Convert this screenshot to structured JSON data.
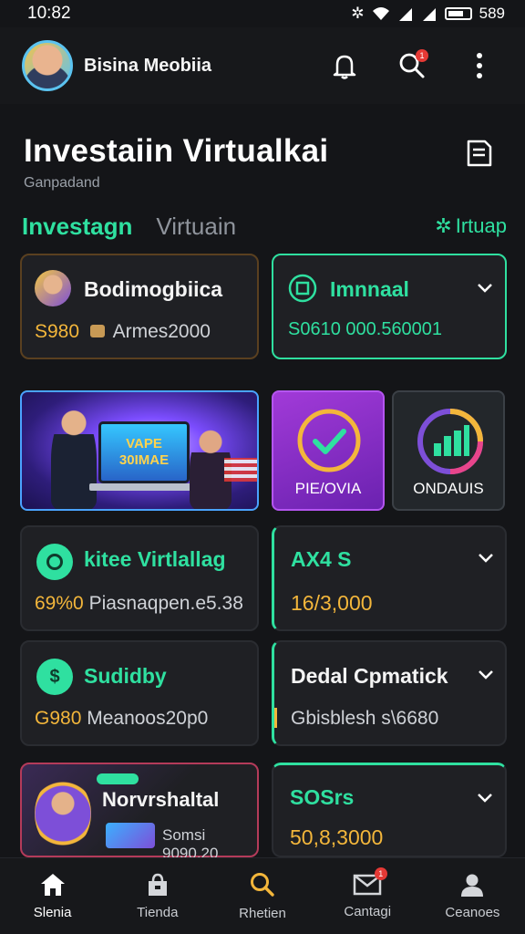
{
  "status_bar": {
    "time": "10:82",
    "battery": "589"
  },
  "header": {
    "user_name": "Bisina Meobiia",
    "notification_badge": "1"
  },
  "page": {
    "title": "Investaiin Virtualkai",
    "subtitle": "Ganpadand"
  },
  "tabs": [
    {
      "label": "Investagn",
      "active": true
    },
    {
      "label": "Virtuain",
      "active": false
    }
  ],
  "tab_right": "Irtuap",
  "cards": [
    {
      "title": "Bodimogbiica",
      "value_prefix": "S980",
      "value_rest": "Armes2000"
    },
    {
      "title": "Imnnaal",
      "value": "S0610 000.560001"
    },
    {
      "title": "kitee Virtlallag",
      "value_prefix": "69%0",
      "value_rest": "Piasnaqpen.e5.38"
    },
    {
      "title": "AX4 S",
      "value": "16/3,000"
    },
    {
      "title": "Sudidby",
      "value_prefix": "G980",
      "value_rest": "Meanoos20p0"
    },
    {
      "title": "Dedal Cpmatick",
      "value": "Gbisblesh s\\6680"
    },
    {
      "title": "Norvrshaltal",
      "value": "Somsi 9090.20"
    },
    {
      "title": "SOSrs",
      "value": "50,8,3000"
    }
  ],
  "promo": {
    "screen_line1": "VAPE",
    "screen_line2": "30IMAE"
  },
  "promo_mini": [
    {
      "label": "PIE/OVIA",
      "color": "#8f2fd0"
    },
    {
      "label": "ONDAUIS",
      "color": "#23272b"
    }
  ],
  "bottom_nav": [
    {
      "label": "Slenia",
      "icon": "home-icon",
      "active": true
    },
    {
      "label": "Tienda",
      "icon": "store-icon",
      "active": false
    },
    {
      "label": "Rhetien",
      "icon": "search-icon",
      "active": false
    },
    {
      "label": "Cantagi",
      "icon": "mail-icon",
      "active": false,
      "badge": "1"
    },
    {
      "label": "Ceanoes",
      "icon": "person-icon",
      "active": false
    }
  ],
  "colors": {
    "accent": "#2fe0a0",
    "gold": "#f3b63b",
    "bg": "#141518",
    "card": "#1f2024"
  }
}
